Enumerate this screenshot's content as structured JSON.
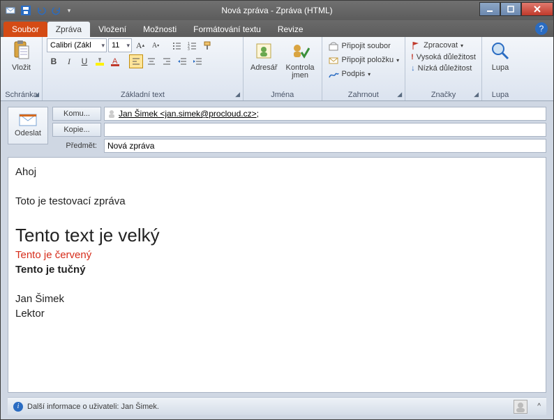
{
  "title": "Nová zpráva - Zpráva (HTML)",
  "tabs": {
    "file": "Soubor",
    "sprava": "Zpráva",
    "vlozeni": "Vložení",
    "moznosti": "Možnosti",
    "format": "Formátování textu",
    "revize": "Revize"
  },
  "ribbon": {
    "schranka": {
      "label": "Schránka",
      "paste": "Vložit"
    },
    "text": {
      "label": "Základní text",
      "font": "Calibri (Zákl",
      "size": "11"
    },
    "jmena": {
      "label": "Jména",
      "adresar": "Adresář",
      "kontrola1": "Kontrola",
      "kontrola2": "jmen"
    },
    "zahrnout": {
      "label": "Zahrnout",
      "soubor": "Připojit soubor",
      "polozku": "Připojit položku",
      "podpis": "Podpis"
    },
    "znacky": {
      "label": "Značky",
      "zpracovat": "Zpracovat",
      "vysoka": "Vysoká důležitost",
      "nizka": "Nízká důležitost"
    },
    "lupa": {
      "label": "Lupa",
      "btn": "Lupa"
    }
  },
  "fields": {
    "send": "Odeslat",
    "to": "Komu...",
    "cc": "Kopie...",
    "subject": "Předmět:",
    "to_value": "Jan Šimek <jan.simek@procloud.cz>",
    "to_suffix": ";",
    "subject_value": "Nová zpráva"
  },
  "body": {
    "l1": "Ahoj",
    "l2": "Toto je testovací zpráva",
    "l3": "Tento text je velký",
    "l4": "Tento je červený",
    "l5": "Tento je tučný",
    "l6": "Jan Šimek",
    "l7": "Lektor"
  },
  "status": "Další informace o uživateli: Jan Šimek."
}
